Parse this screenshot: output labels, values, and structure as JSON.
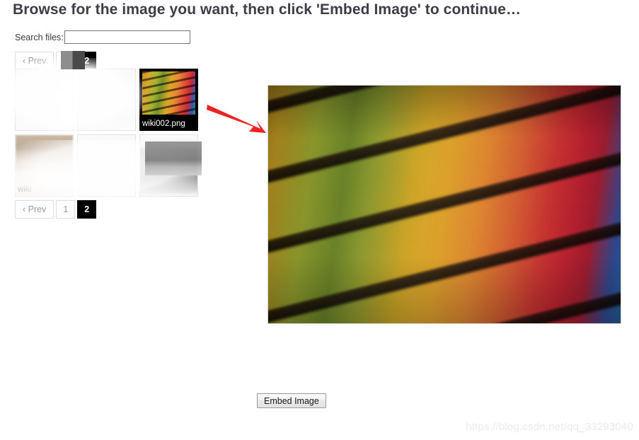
{
  "page": {
    "title": "Browse for the image you want, then click 'Embed Image' to continue…",
    "watermark": "https://blog.csdn.net/qq_33293040"
  },
  "search": {
    "label": "Search files:",
    "value": "",
    "placeholder": ""
  },
  "pagination_top": {
    "prev_label": "‹ Prev",
    "pages": [
      {
        "label": "1",
        "active": false
      },
      {
        "label": "2",
        "active": true
      }
    ]
  },
  "pagination_bottom": {
    "prev_label": "‹ Prev",
    "pages": [
      {
        "label": "1",
        "active": false
      },
      {
        "label": "2",
        "active": true
      }
    ]
  },
  "file_grid": {
    "tiles": [
      {
        "name": "",
        "art": "art-blur-doc",
        "selected": false
      },
      {
        "name": "",
        "art": "art-blur-plain",
        "selected": false
      },
      {
        "name": "wiki002.png",
        "art": "art-rainbow",
        "selected": true
      },
      {
        "name": "wiki",
        "art": "art-blur-room",
        "selected": false
      },
      {
        "name": "",
        "art": "art-blur-plain",
        "selected": false
      },
      {
        "name": "",
        "art": "art-blur-grey",
        "selected": false
      }
    ]
  },
  "preview": {
    "alt_text": "wiki002.png",
    "description": "Colourful stacks of paper on shelves, rainbow gradient from yellow through green, orange, red to blue"
  },
  "footer": {
    "embed_label": "Embed Image"
  },
  "colors": {
    "accent_selected": "#000000",
    "arrow": "#ee2222",
    "title_text": "#3d3d47",
    "muted_text": "#9a9a9a",
    "border": "#dddddd"
  }
}
